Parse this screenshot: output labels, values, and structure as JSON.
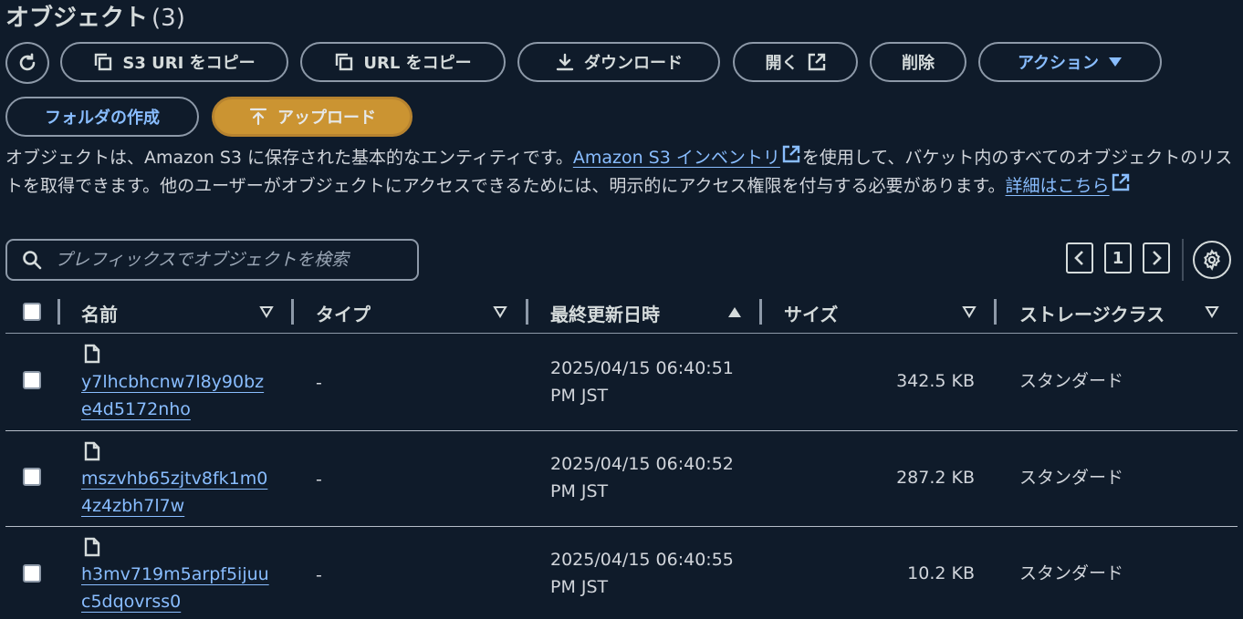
{
  "header": {
    "title": "オブジェクト",
    "count": "(3)"
  },
  "toolbar": {
    "refresh_icon": "refresh-icon",
    "copy_s3_uri": "S3 URI をコピー",
    "copy_url": "URL をコピー",
    "download": "ダウンロード",
    "open": "開く",
    "delete": "削除",
    "actions": "アクション",
    "create_folder": "フォルダの作成",
    "upload": "アップロード"
  },
  "description": {
    "text1": "オブジェクトは、Amazon S3 に保存された基本的なエンティティです。",
    "link1": "Amazon S3 インベントリ",
    "text2": "を使用して、バケット内のすべてのオブジェクトのリストを取得できます。他のユーザーがオブジェクトにアクセスできるためには、明示的にアクセス権限を付与する必要があります。",
    "link2": "詳細はこちら"
  },
  "search": {
    "placeholder": "プレフィックスでオブジェクトを検索"
  },
  "pagination": {
    "current_page": "1"
  },
  "table": {
    "columns": {
      "name": "名前",
      "type": "タイプ",
      "modified": "最終更新日時",
      "size": "サイズ",
      "storage_class": "ストレージクラス"
    },
    "rows": [
      {
        "name_line1": "y7lhcbhcnw7l8y90bz",
        "name_line2": "e4d5172nho",
        "type": "-",
        "modified_line1": "2025/04/15 06:40:51",
        "modified_line2": "PM JST",
        "size": "342.5 KB",
        "storage_class": "スタンダード"
      },
      {
        "name_line1": "mszvhb65zjtv8fk1m0",
        "name_line2": "4z4zbh7l7w",
        "type": "-",
        "modified_line1": "2025/04/15 06:40:52",
        "modified_line2": "PM JST",
        "size": "287.2 KB",
        "storage_class": "スタンダード"
      },
      {
        "name_line1": "h3mv719m5arpf5ijuu",
        "name_line2": "c5dqovrss0",
        "type": "-",
        "modified_line1": "2025/04/15 06:40:55",
        "modified_line2": "PM JST",
        "size": "10.2 KB",
        "storage_class": "スタンダード"
      }
    ]
  },
  "colors": {
    "background": "#0f1b2a",
    "link": "#89bdff",
    "primary": "#e8a33b",
    "border": "#8d99a8"
  }
}
